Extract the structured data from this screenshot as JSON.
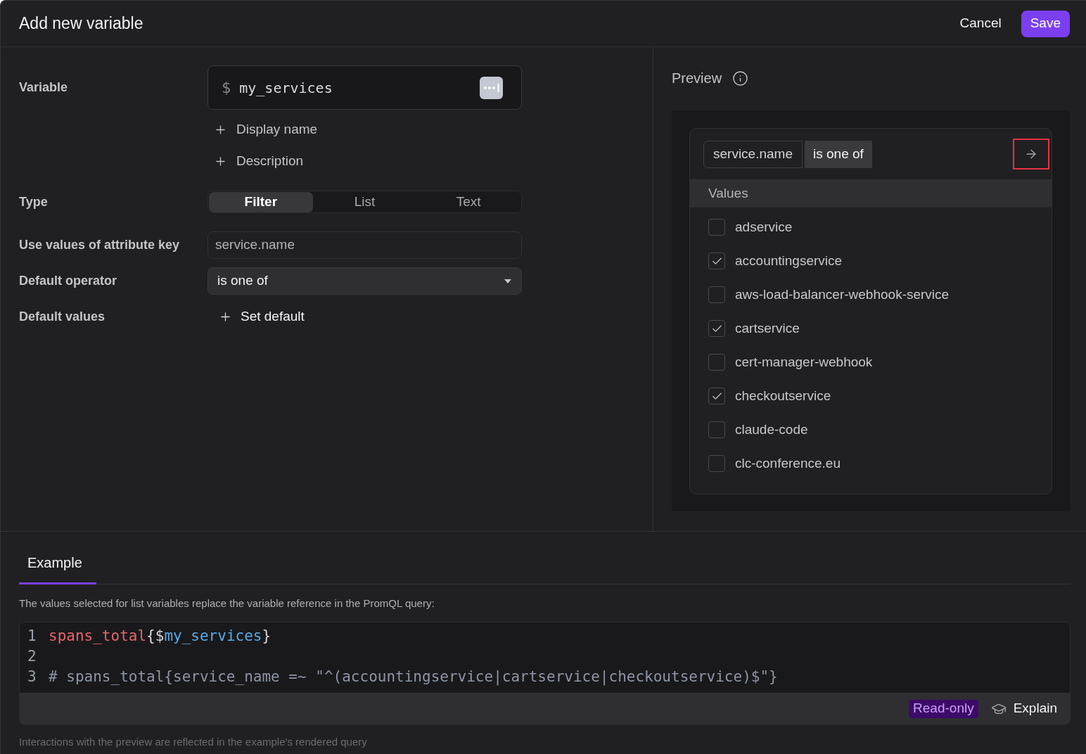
{
  "dialog": {
    "title": "Add new variable",
    "actions": [
      {
        "label": "Cancel",
        "kind": "secondary"
      },
      {
        "label": "Save",
        "kind": "primary"
      }
    ]
  },
  "form": {
    "variable": {
      "label": "Variable",
      "prefix": "$",
      "value": "my_services"
    },
    "optional_fields": [
      {
        "label": "Display name"
      },
      {
        "label": "Description"
      }
    ],
    "type": {
      "label": "Type",
      "options": [
        {
          "label": "Filter",
          "selected": true
        },
        {
          "label": "List",
          "selected": false
        },
        {
          "label": "Text",
          "selected": false
        }
      ]
    },
    "attribute_key": {
      "label": "Use values of attribute key",
      "value": "service.name"
    },
    "default_operator": {
      "label": "Default operator",
      "value": "is one of"
    },
    "default_values": {
      "label": "Default values",
      "action": "Set default"
    }
  },
  "preview": {
    "title": "Preview",
    "filter": {
      "key": "service.name",
      "operator": "is one of",
      "apply_highlighted": true
    },
    "values_header": "Values",
    "values": [
      {
        "label": "adservice",
        "checked": false
      },
      {
        "label": "accountingservice",
        "checked": true
      },
      {
        "label": "aws-load-balancer-webhook-service",
        "checked": false
      },
      {
        "label": "cartservice",
        "checked": true
      },
      {
        "label": "cert-manager-webhook",
        "checked": false
      },
      {
        "label": "checkoutservice",
        "checked": true
      },
      {
        "label": "claude-code",
        "checked": false
      },
      {
        "label": "clc-conference.eu",
        "checked": false
      }
    ]
  },
  "example": {
    "tabs": [
      {
        "label": "Example",
        "selected": true
      }
    ],
    "description": "The values selected for list variables replace the variable reference in the PromQL query:",
    "code": {
      "lines": [
        {
          "number": "1",
          "tokens": [
            {
              "kind": "metric",
              "text": "spans_total"
            },
            {
              "kind": "punctuation",
              "text": "{$"
            },
            {
              "kind": "variable",
              "text": "my_services"
            },
            {
              "kind": "punctuation",
              "text": "}"
            }
          ]
        },
        {
          "number": "2"
        },
        {
          "number": "3",
          "tokens": [
            {
              "kind": "comment",
              "text": "# spans_total{service_name =~ \"^(accountingservice|cartservice|checkoutservice)$\"}"
            }
          ]
        }
      ]
    },
    "badge": "Read-only",
    "explain": "Explain",
    "note": "Interactions with the preview are reflected in the example's rendered query"
  }
}
